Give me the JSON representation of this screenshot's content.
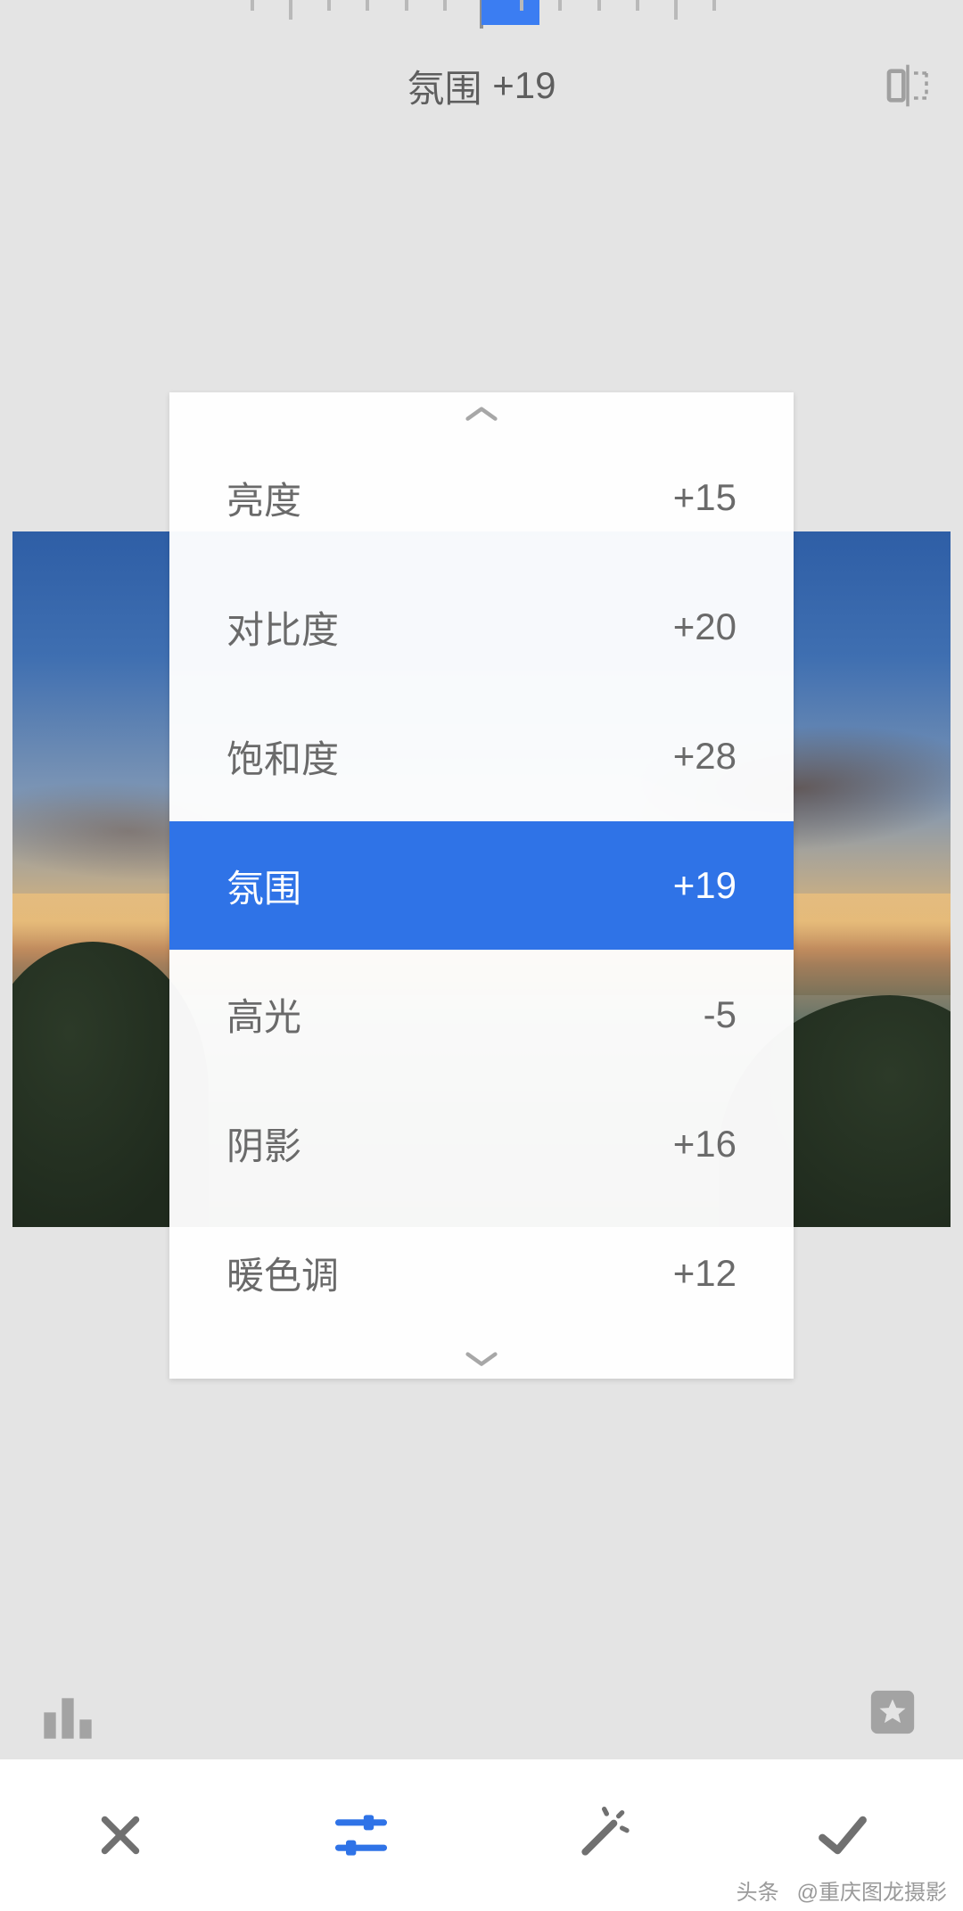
{
  "header": {
    "current_param_label": "氛围",
    "current_param_value": "+19"
  },
  "slider": {
    "value": 19,
    "min": -100,
    "max": 100
  },
  "params": [
    {
      "label": "亮度",
      "value": "+15",
      "selected": false
    },
    {
      "label": "对比度",
      "value": "+20",
      "selected": false
    },
    {
      "label": "饱和度",
      "value": "+28",
      "selected": false
    },
    {
      "label": "氛围",
      "value": "+19",
      "selected": true
    },
    {
      "label": "高光",
      "value": "-5",
      "selected": false
    },
    {
      "label": "阴影",
      "value": "+16",
      "selected": false
    },
    {
      "label": "暖色调",
      "value": "+12",
      "selected": false
    }
  ],
  "toolbar": {
    "close_label": "close",
    "adjust_label": "adjust",
    "magic_label": "auto",
    "confirm_label": "confirm"
  },
  "watermark": {
    "prefix": "头条",
    "handle": "@重庆图龙摄影"
  },
  "colors": {
    "accent": "#2f73e7",
    "panel_bg": "#ffffff",
    "app_bg": "#e4e4e4"
  }
}
